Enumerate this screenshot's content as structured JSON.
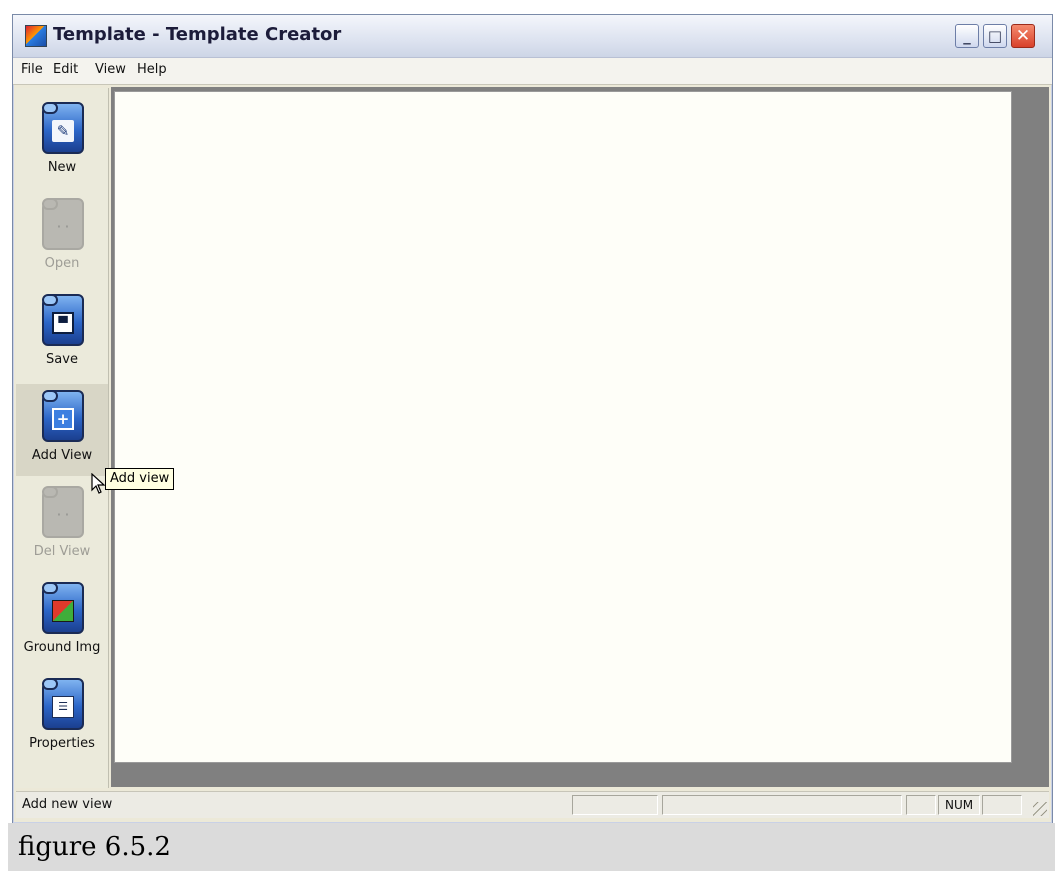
{
  "window": {
    "title": "Template - Template Creator",
    "icons": {
      "app": "app-icon",
      "minimize": "minimize-icon",
      "maximize": "maximize-icon",
      "close": "close-icon"
    }
  },
  "menu": [
    "File",
    "Edit",
    "View",
    "Help"
  ],
  "toolbar": [
    {
      "label": "New",
      "icon": "new-icon",
      "enabled": true
    },
    {
      "label": "Open",
      "icon": "open-icon",
      "enabled": false
    },
    {
      "label": "Save",
      "icon": "save-icon",
      "enabled": true
    },
    {
      "label": "Add View",
      "icon": "add-view-icon",
      "enabled": true
    },
    {
      "label": "Del View",
      "icon": "del-view-icon",
      "enabled": false
    },
    {
      "label": "Ground Img",
      "icon": "ground-img-icon",
      "enabled": true
    },
    {
      "label": "Properties",
      "icon": "properties-icon",
      "enabled": true
    }
  ],
  "tooltip": "Add view",
  "status": {
    "text": "Add new view",
    "num": "NUM"
  },
  "caption": "figure 6.5.2",
  "colors": {
    "canvas": "#fefef8",
    "workspace": "#808080",
    "tooltip_bg": "#ffffe1",
    "close_button": "#d8412b"
  }
}
